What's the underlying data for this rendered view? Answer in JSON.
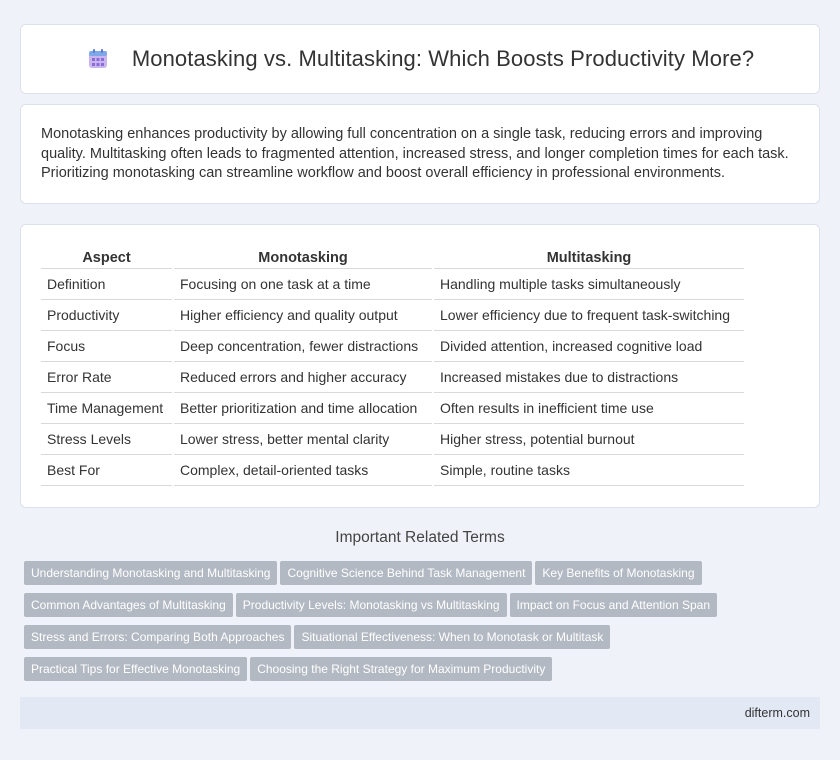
{
  "header": {
    "title": "Monotasking vs. Multitasking: Which Boosts Productivity More?",
    "icon": "calendar-icon"
  },
  "intro": {
    "text": "Monotasking enhances productivity by allowing full concentration on a single task, reducing errors and improving quality. Multitasking often leads to fragmented attention, increased stress, and longer completion times for each task. Prioritizing monotasking can streamline workflow and boost overall efficiency in professional environments."
  },
  "table": {
    "headers": [
      "Aspect",
      "Monotasking",
      "Multitasking"
    ],
    "rows": [
      [
        "Definition",
        "Focusing on one task at a time",
        "Handling multiple tasks simultaneously"
      ],
      [
        "Productivity",
        "Higher efficiency and quality output",
        "Lower efficiency due to frequent task-switching"
      ],
      [
        "Focus",
        "Deep concentration, fewer distractions",
        "Divided attention, increased cognitive load"
      ],
      [
        "Error Rate",
        "Reduced errors and higher accuracy",
        "Increased mistakes due to distractions"
      ],
      [
        "Time Management",
        "Better prioritization and time allocation",
        "Often results in inefficient time use"
      ],
      [
        "Stress Levels",
        "Lower stress, better mental clarity",
        "Higher stress, potential burnout"
      ],
      [
        "Best For",
        "Complex, detail-oriented tasks",
        "Simple, routine tasks"
      ]
    ]
  },
  "terms": {
    "title": "Important Related Terms",
    "rows": [
      [
        "Understanding Monotasking and Multitasking",
        "Cognitive Science Behind Task Management",
        "Key Benefits of Monotasking"
      ],
      [
        "Common Advantages of Multitasking",
        "Productivity Levels: Monotasking vs Multitasking",
        "Impact on Focus and Attention Span"
      ],
      [
        "Stress and Errors: Comparing Both Approaches",
        "Situational Effectiveness: When to Monotask or Multitask"
      ],
      [
        "Practical Tips for Effective Monotasking",
        "Choosing the Right Strategy for Maximum Productivity"
      ]
    ]
  },
  "footer": {
    "site": "difterm.com"
  }
}
